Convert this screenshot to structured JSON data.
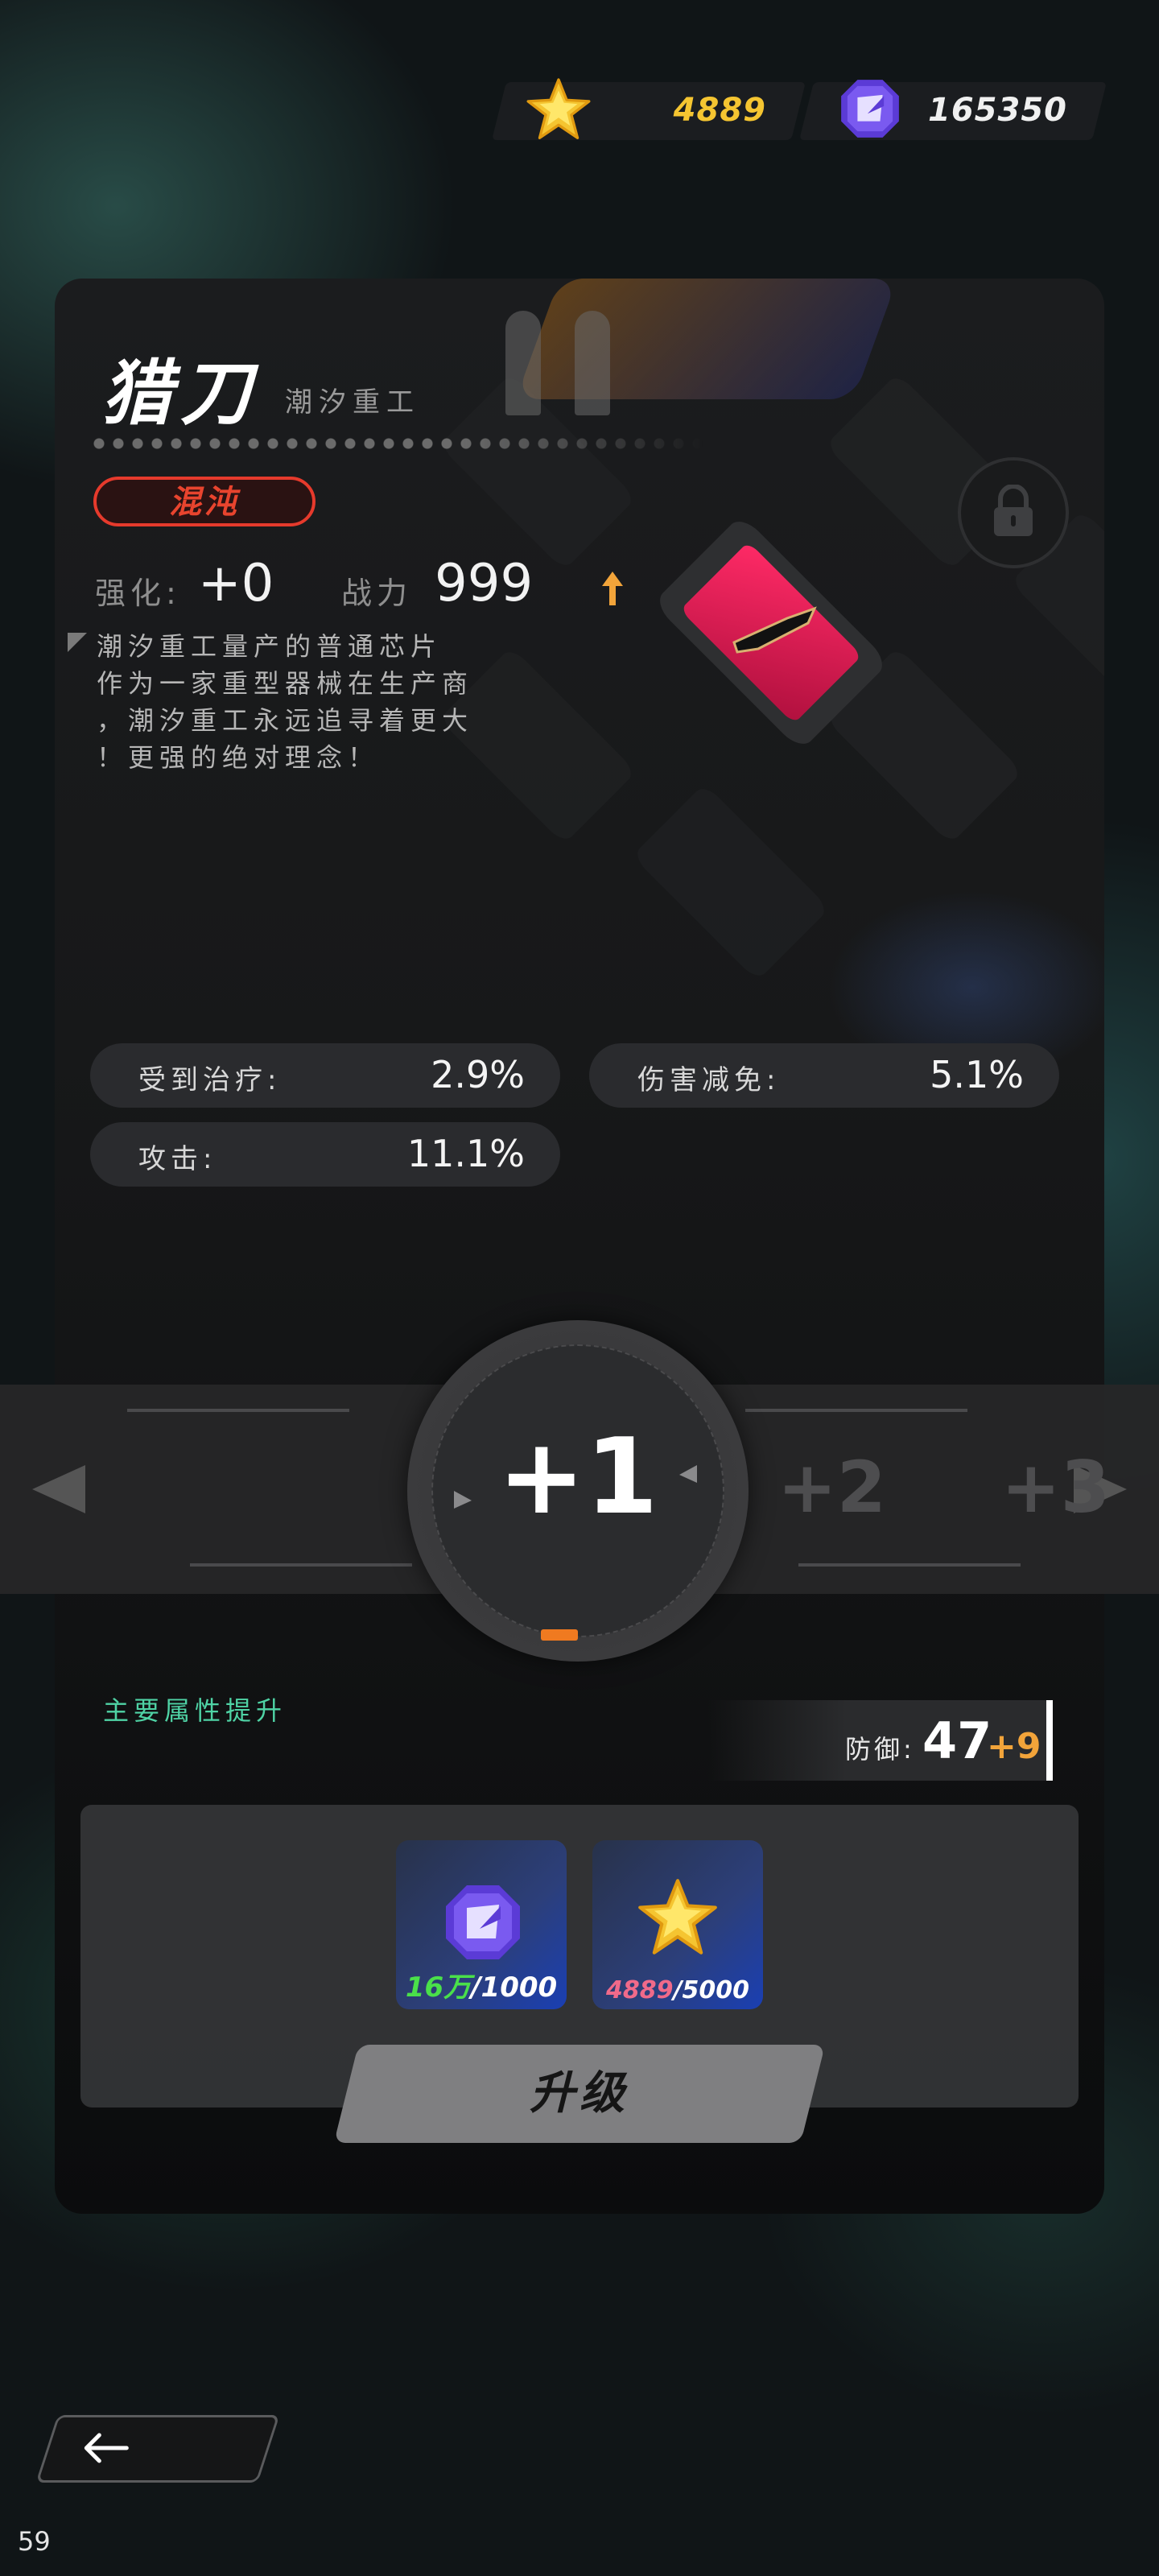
{
  "currency": {
    "stars": "4889",
    "crystals": "165350"
  },
  "chip": {
    "name": "猎刀",
    "maker": "潮汐重工",
    "rarity": "混沌",
    "enhance_label": "强化:",
    "enhance_value": "+0",
    "power_label": "战力",
    "power_value": "999",
    "description": [
      "潮汐重工量产的普通芯片",
      "作为一家重型器械在生产商",
      "，潮汐重工永远追寻着更大",
      "！更强的绝对理念！"
    ]
  },
  "stats": [
    {
      "label": "受到治疗:",
      "value": "2.9%"
    },
    {
      "label": "伤害减免:",
      "value": "5.1%"
    },
    {
      "label": "攻击:",
      "value": "11.1%"
    }
  ],
  "selector": {
    "current": "+1",
    "next1": "+2",
    "next2": "+3"
  },
  "upgrade": {
    "section_label": "主要属性提升",
    "attr_label": "防御:",
    "attr_value": "47",
    "attr_bonus": "+9",
    "costs": [
      {
        "icon": "crystal-icon",
        "have": "16万",
        "need": "/1000",
        "have_color": "#4ae04a"
      },
      {
        "icon": "star-icon",
        "have": "4889",
        "need": "/5000",
        "have_color": "#f06a8a"
      }
    ],
    "button_label": "升级"
  },
  "fps": "59",
  "colors": {
    "gold": "#f5c531",
    "rarity_red": "#e63a2c",
    "accent_green": "#4fd3a5",
    "bonus_orange": "#f2a43a",
    "chip_pink": "#d0154a"
  }
}
